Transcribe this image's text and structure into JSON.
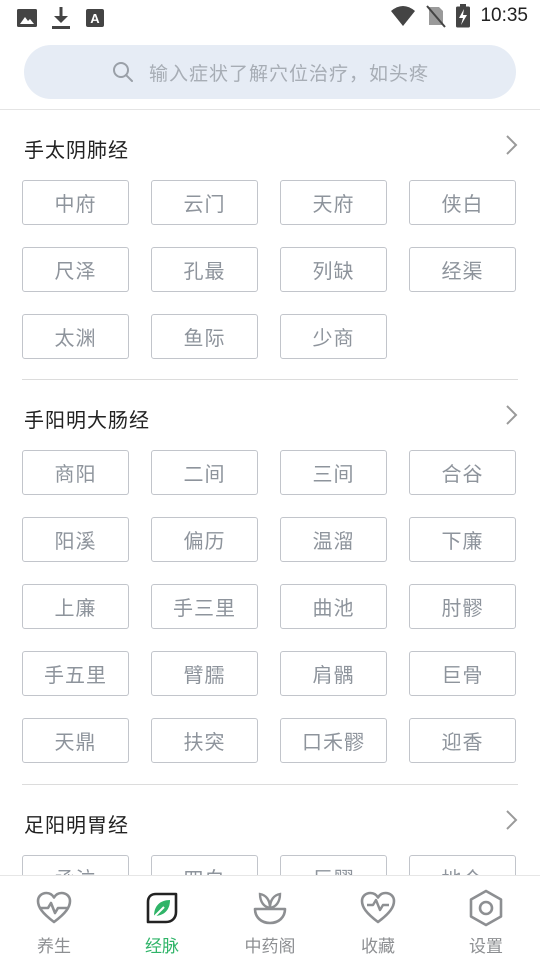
{
  "status_bar": {
    "time": "10:35",
    "left_icons": [
      "image-icon",
      "download-icon",
      "text-a-icon"
    ],
    "right_icons": [
      "wifi-icon",
      "no-sim-icon",
      "battery-charging-icon"
    ]
  },
  "search": {
    "placeholder": "输入症状了解穴位治疗，如头疼"
  },
  "sections": [
    {
      "title": "手太阴肺经",
      "points": [
        "中府",
        "云门",
        "天府",
        "侠白",
        "尺泽",
        "孔最",
        "列缺",
        "经渠",
        "太渊",
        "鱼际",
        "少商"
      ]
    },
    {
      "title": "手阳明大肠经",
      "points": [
        "商阳",
        "二间",
        "三间",
        "合谷",
        "阳溪",
        "偏历",
        "温溜",
        "下廉",
        "上廉",
        "手三里",
        "曲池",
        "肘髎",
        "手五里",
        "臂臑",
        "肩髃",
        "巨骨",
        "天鼎",
        "扶突",
        "口禾髎",
        "迎香"
      ]
    },
    {
      "title": "足阳明胃经",
      "points": [
        "承泣",
        "四白",
        "巨髎",
        "地仓"
      ]
    }
  ],
  "tabbar": {
    "active_color": "#2fb468",
    "inactive_color": "#8d8f92",
    "tabs": [
      {
        "label": "养生",
        "icon": "heart-pulse-icon",
        "active": false
      },
      {
        "label": "经脉",
        "icon": "leaf-icon",
        "active": true
      },
      {
        "label": "中药阁",
        "icon": "herb-bowl-icon",
        "active": false
      },
      {
        "label": "收藏",
        "icon": "heart-favorite-icon",
        "active": false
      },
      {
        "label": "设置",
        "icon": "settings-hexagon-icon",
        "active": false
      }
    ]
  }
}
